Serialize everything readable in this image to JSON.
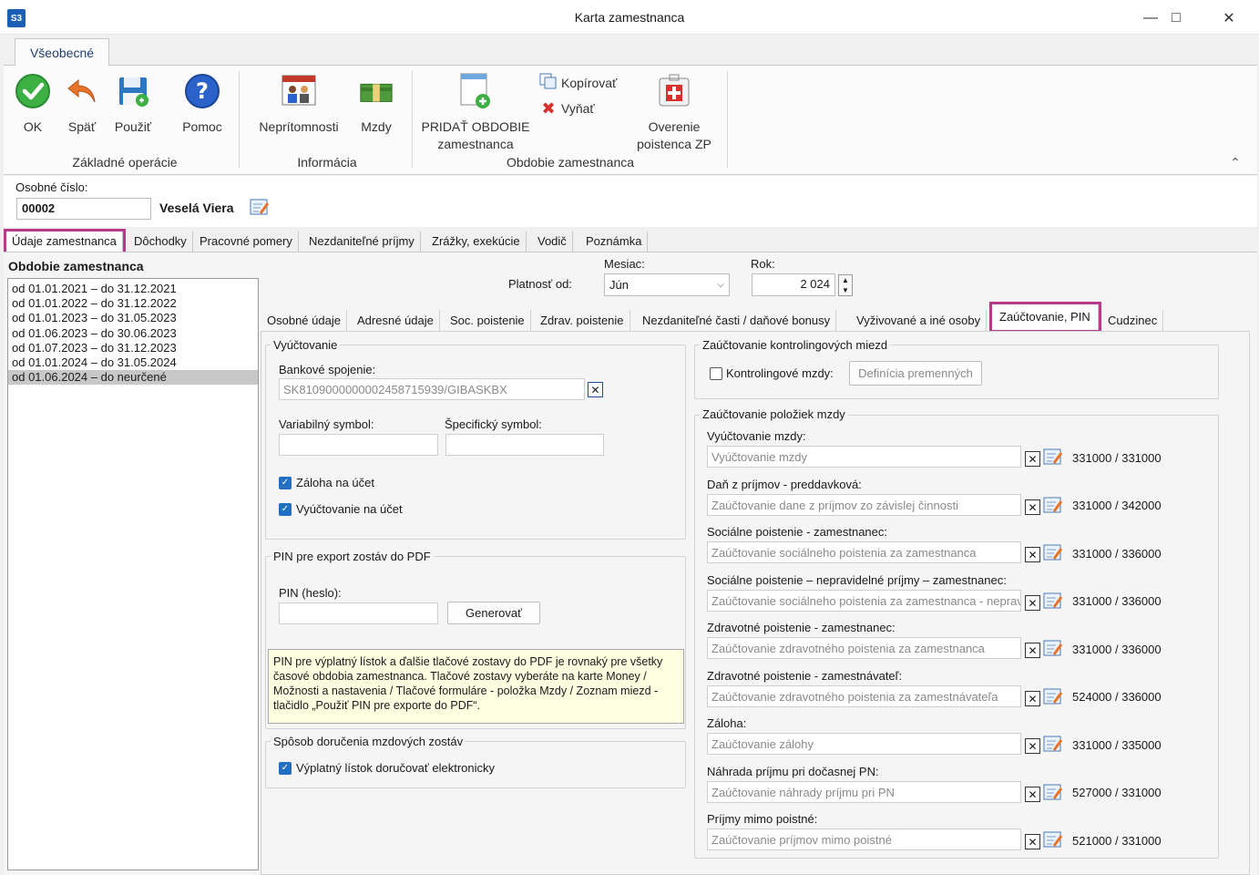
{
  "window": {
    "title": "Karta zamestnanca",
    "app_icon": "S3"
  },
  "ribbon": {
    "tab": "Všeobecné",
    "buttons": {
      "ok": "OK",
      "back": "Späť",
      "use": "Použiť",
      "help": "Pomoc",
      "absences": "Neprítomnosti",
      "wages": "Mzdy",
      "add_period_1": "PRIDAŤ OBDOBIE",
      "add_period_2": "zamestnanca",
      "copy": "Kopírovať",
      "cut": "Vyňať",
      "verify_1": "Overenie",
      "verify_2": "poistenca ZP"
    },
    "groups": {
      "basic": "Základné operácie",
      "info": "Informácia",
      "period": "Obdobie zamestnanca"
    }
  },
  "employee": {
    "number_label": "Osobné číslo:",
    "number": "00002",
    "name": "Veselá Viera"
  },
  "main_tabs": [
    "Údaje zamestnanca",
    "Dôchodky",
    "Pracovné pomery",
    "Nezdaniteľné príjmy",
    "Zrážky, exekúcie",
    "Vodič",
    "Poznámka"
  ],
  "periods": {
    "title": "Obdobie zamestnanca",
    "items": [
      "od 01.01.2021 – do 31.12.2021",
      "od 01.01.2022 – do 31.12.2022",
      "od 01.01.2023 – do 31.05.2023",
      "od 01.06.2023 – do 30.06.2023",
      "od 01.07.2023 – do 31.12.2023",
      "od 01.01.2024 – do 31.05.2024",
      "od 01.06.2024 – do neurčené"
    ]
  },
  "validity": {
    "label": "Platnosť od:",
    "month_label": "Mesiac:",
    "month": "Jún",
    "year_label": "Rok:",
    "year": "2 024"
  },
  "sub_tabs": [
    "Osobné údaje",
    "Adresné údaje",
    "Soc. poistenie",
    "Zdrav. poistenie",
    "Nezdaniteľné časti  / daňové bonusy",
    "Vyživované a iné osoby",
    "Zaúčtovanie, PIN",
    "Cudzinec"
  ],
  "billing": {
    "title": "Vyúčtovanie",
    "bank_label": "Bankové spojenie:",
    "bank_value": "SK8109000000002458715939/GIBASKBX",
    "var_symbol_label": "Variabilný symbol:",
    "spec_symbol_label": "Špecifický symbol:",
    "advance": "Záloha na účet",
    "settlement": "Vyúčtovanie na účet"
  },
  "pin": {
    "title": "PIN pre export zostáv do PDF",
    "label": "PIN (heslo):",
    "generate": "Generovať",
    "info": "PIN pre výplatný lístok a ďalšie tlačové zostavy do PDF je rovnaký pre všetky časové obdobia zamestnanca. Tlačové zostavy vyberáte na karte Money / Možnosti a nastavenia / Tlačové formuláre - položka Mzdy / Zoznam miezd - tlačidlo „Použiť PIN pre exporte do PDF“."
  },
  "delivery": {
    "title": "Spôsob doručenia mzdových zostáv",
    "electronic": "Výplatný lístok doručovať elektronicky"
  },
  "controlling": {
    "title": "Zaúčtovanie kontrolingových miezd",
    "checkbox": "Kontrolingové mzdy:",
    "button": "Definícia premenných"
  },
  "posting": {
    "title": "Zaúčtovanie položiek mzdy",
    "rows": [
      {
        "label": "Vyúčtovanie mzdy:",
        "placeholder": "Vyúčtovanie mzdy",
        "accounts": "331000 / 331000"
      },
      {
        "label": "Daň z príjmov - preddavková:",
        "placeholder": "Zaúčtovanie dane z príjmov zo závislej činnosti",
        "accounts": "331000 / 342000"
      },
      {
        "label": "Sociálne poistenie - zamestnanec:",
        "placeholder": "Zaúčtovanie sociálneho poistenia za zamestnanca",
        "accounts": "331000 / 336000"
      },
      {
        "label": "Sociálne poistenie – nepravidelné príjmy – zamestnanec:",
        "placeholder": "Zaúčtovanie sociálneho poistenia za zamestnanca - nepravidelné príjmy",
        "accounts": "331000 / 336000"
      },
      {
        "label": "Zdravotné poistenie - zamestnanec:",
        "placeholder": "Zaúčtovanie zdravotného poistenia za zamestnanca",
        "accounts": "331000 / 336000"
      },
      {
        "label": "Zdravotné poistenie - zamestnávateľ:",
        "placeholder": "Zaúčtovanie zdravotného poistenia za zamestnávateľa",
        "accounts": "524000 / 336000"
      },
      {
        "label": "Záloha:",
        "placeholder": "Zaúčtovanie zálohy",
        "accounts": "331000 / 335000"
      },
      {
        "label": "Náhrada príjmu pri dočasnej PN:",
        "placeholder": "Zaúčtovanie náhrady príjmu pri PN",
        "accounts": "527000 / 331000"
      },
      {
        "label": "Príjmy mimo poistné:",
        "placeholder": "Zaúčtovanie príjmov mimo poistné",
        "accounts": "521000 / 331000"
      }
    ]
  },
  "colors": {
    "highlight": "#b53b8a",
    "checkbox": "#1f6fc5",
    "info_bg": "#ffffe1"
  }
}
